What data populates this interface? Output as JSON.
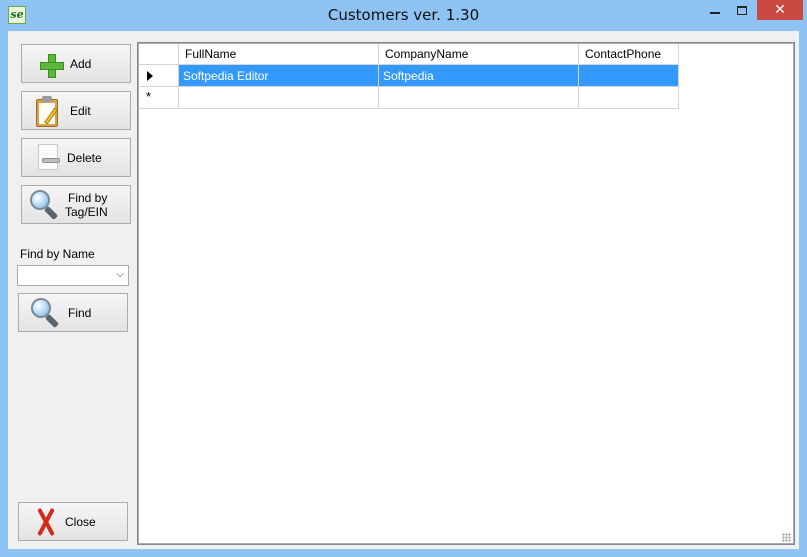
{
  "window": {
    "title": "Customers ver. 1.30",
    "app_icon_text": "se",
    "close_glyph": "✕",
    "accent": "#8fc3f3",
    "close_color": "#c7493f"
  },
  "sidebar": {
    "add_label": "Add",
    "edit_label": "Edit",
    "delete_label": "Delete",
    "find_tag_line1": "Find by",
    "find_tag_line2": "Tag/EIN",
    "find_by_name_label": "Find by Name",
    "find_by_name_value": "",
    "find_label": "Find",
    "close_label": "Close"
  },
  "grid": {
    "columns": [
      "FullName",
      "CompanyName",
      "ContactPhone"
    ],
    "rows": [
      {
        "full_name": "Softpedia Editor",
        "company_name": "Softpedia",
        "contact_phone": "",
        "selected": true
      }
    ],
    "new_row_glyph": "*",
    "selection_color": "#3399ff"
  }
}
